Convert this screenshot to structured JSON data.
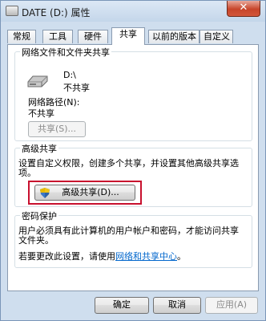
{
  "window": {
    "title": "DATE (D:) 属性",
    "close_glyph": "✕"
  },
  "tabs": [
    {
      "label": "常规"
    },
    {
      "label": "工具"
    },
    {
      "label": "硬件"
    },
    {
      "label": "共享"
    },
    {
      "label": "以前的版本"
    },
    {
      "label": "自定义"
    }
  ],
  "sharing": {
    "title": "网络文件和文件夹共享",
    "drive_name": "D:\\",
    "drive_status": "不共享",
    "network_path_label": "网络路径(N):",
    "network_path_value": "不共享",
    "share_button": "共享(S)..."
  },
  "advanced": {
    "title": "高级共享",
    "description_line1": "设置自定义权限，创建多个共享，并设置其他高级共享选",
    "description_line2": "项。",
    "button": "高级共享(D)..."
  },
  "password": {
    "title": "密码保护",
    "line1": "用户必须具有此计算机的用户帐户和密码，才能访问共享",
    "line2": "文件夹。",
    "change_prefix": "若要更改此设置，请使用",
    "link": "网络和共享中心",
    "change_suffix": "。"
  },
  "footer": {
    "ok": "确定",
    "cancel": "取消",
    "apply": "应用(A)"
  },
  "colors": {
    "highlight": "#c8102e",
    "link": "#0066cc"
  }
}
